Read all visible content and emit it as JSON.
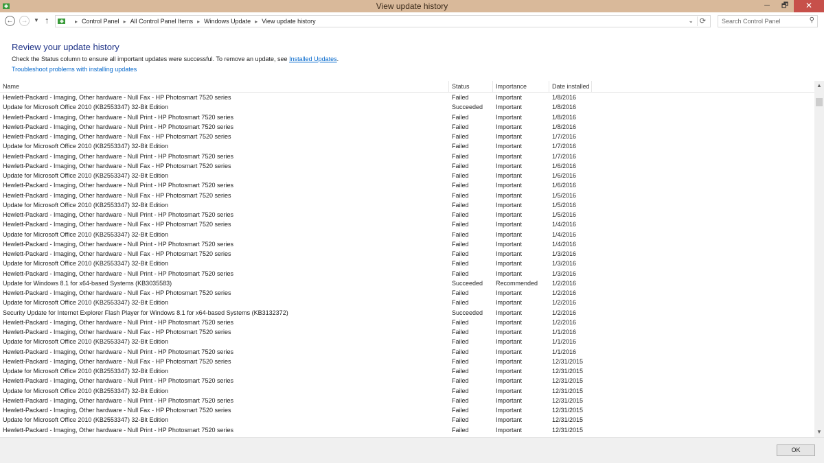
{
  "window": {
    "title": "View update history",
    "minimize": "─",
    "maximize": "🗗",
    "close": "✕"
  },
  "nav": {
    "breadcrumbs": [
      "Control Panel",
      "All Control Panel Items",
      "Windows Update",
      "View update history"
    ],
    "search_placeholder": "Search Control Panel"
  },
  "page": {
    "heading": "Review your update history",
    "desc_text": "Check the Status column to ensure all important updates were successful. To remove an update, see ",
    "installed_updates_link": "Installed Updates",
    "desc_end": ".",
    "troubleshoot_link": "Troubleshoot problems with installing updates"
  },
  "table": {
    "columns": [
      "Name",
      "Status",
      "Importance",
      "Date installed"
    ],
    "rows": [
      [
        "Hewlett-Packard  - Imaging, Other hardware - Null Fax - HP Photosmart 7520 series",
        "Failed",
        "Important",
        "1/8/2016"
      ],
      [
        "Update for Microsoft Office 2010 (KB2553347) 32-Bit Edition",
        "Succeeded",
        "Important",
        "1/8/2016"
      ],
      [
        "Hewlett-Packard  - Imaging, Other hardware - Null Print - HP Photosmart 7520 series",
        "Failed",
        "Important",
        "1/8/2016"
      ],
      [
        "Hewlett-Packard  - Imaging, Other hardware - Null Print - HP Photosmart 7520 series",
        "Failed",
        "Important",
        "1/8/2016"
      ],
      [
        "Hewlett-Packard  - Imaging, Other hardware - Null Fax - HP Photosmart 7520 series",
        "Failed",
        "Important",
        "1/7/2016"
      ],
      [
        "Update for Microsoft Office 2010 (KB2553347) 32-Bit Edition",
        "Failed",
        "Important",
        "1/7/2016"
      ],
      [
        "Hewlett-Packard  - Imaging, Other hardware - Null Print - HP Photosmart 7520 series",
        "Failed",
        "Important",
        "1/7/2016"
      ],
      [
        "Hewlett-Packard  - Imaging, Other hardware - Null Fax - HP Photosmart 7520 series",
        "Failed",
        "Important",
        "1/6/2016"
      ],
      [
        "Update for Microsoft Office 2010 (KB2553347) 32-Bit Edition",
        "Failed",
        "Important",
        "1/6/2016"
      ],
      [
        "Hewlett-Packard  - Imaging, Other hardware - Null Print - HP Photosmart 7520 series",
        "Failed",
        "Important",
        "1/6/2016"
      ],
      [
        "Hewlett-Packard  - Imaging, Other hardware - Null Fax - HP Photosmart 7520 series",
        "Failed",
        "Important",
        "1/5/2016"
      ],
      [
        "Update for Microsoft Office 2010 (KB2553347) 32-Bit Edition",
        "Failed",
        "Important",
        "1/5/2016"
      ],
      [
        "Hewlett-Packard  - Imaging, Other hardware - Null Print - HP Photosmart 7520 series",
        "Failed",
        "Important",
        "1/5/2016"
      ],
      [
        "Hewlett-Packard  - Imaging, Other hardware - Null Fax - HP Photosmart 7520 series",
        "Failed",
        "Important",
        "1/4/2016"
      ],
      [
        "Update for Microsoft Office 2010 (KB2553347) 32-Bit Edition",
        "Failed",
        "Important",
        "1/4/2016"
      ],
      [
        "Hewlett-Packard  - Imaging, Other hardware - Null Print - HP Photosmart 7520 series",
        "Failed",
        "Important",
        "1/4/2016"
      ],
      [
        "Hewlett-Packard  - Imaging, Other hardware - Null Fax - HP Photosmart 7520 series",
        "Failed",
        "Important",
        "1/3/2016"
      ],
      [
        "Update for Microsoft Office 2010 (KB2553347) 32-Bit Edition",
        "Failed",
        "Important",
        "1/3/2016"
      ],
      [
        "Hewlett-Packard  - Imaging, Other hardware - Null Print - HP Photosmart 7520 series",
        "Failed",
        "Important",
        "1/3/2016"
      ],
      [
        "Update for Windows 8.1 for x64-based Systems (KB3035583)",
        "Succeeded",
        "Recommended",
        "1/2/2016"
      ],
      [
        "Hewlett-Packard  - Imaging, Other hardware - Null Fax - HP Photosmart 7520 series",
        "Failed",
        "Important",
        "1/2/2016"
      ],
      [
        "Update for Microsoft Office 2010 (KB2553347) 32-Bit Edition",
        "Failed",
        "Important",
        "1/2/2016"
      ],
      [
        "Security Update for Internet Explorer Flash Player for Windows 8.1 for x64-based Systems (KB3132372)",
        "Succeeded",
        "Important",
        "1/2/2016"
      ],
      [
        "Hewlett-Packard  - Imaging, Other hardware - Null Print - HP Photosmart 7520 series",
        "Failed",
        "Important",
        "1/2/2016"
      ],
      [
        "Hewlett-Packard  - Imaging, Other hardware - Null Fax - HP Photosmart 7520 series",
        "Failed",
        "Important",
        "1/1/2016"
      ],
      [
        "Update for Microsoft Office 2010 (KB2553347) 32-Bit Edition",
        "Failed",
        "Important",
        "1/1/2016"
      ],
      [
        "Hewlett-Packard  - Imaging, Other hardware - Null Print - HP Photosmart 7520 series",
        "Failed",
        "Important",
        "1/1/2016"
      ],
      [
        "Hewlett-Packard  - Imaging, Other hardware - Null Fax - HP Photosmart 7520 series",
        "Failed",
        "Important",
        "12/31/2015"
      ],
      [
        "Update for Microsoft Office 2010 (KB2553347) 32-Bit Edition",
        "Failed",
        "Important",
        "12/31/2015"
      ],
      [
        "Hewlett-Packard  - Imaging, Other hardware - Null Print - HP Photosmart 7520 series",
        "Failed",
        "Important",
        "12/31/2015"
      ],
      [
        "Update for Microsoft Office 2010 (KB2553347) 32-Bit Edition",
        "Failed",
        "Important",
        "12/31/2015"
      ],
      [
        "Hewlett-Packard  - Imaging, Other hardware - Null Print - HP Photosmart 7520 series",
        "Failed",
        "Important",
        "12/31/2015"
      ],
      [
        "Hewlett-Packard  - Imaging, Other hardware - Null Fax - HP Photosmart 7520 series",
        "Failed",
        "Important",
        "12/31/2015"
      ],
      [
        "Update for Microsoft Office 2010 (KB2553347) 32-Bit Edition",
        "Failed",
        "Important",
        "12/31/2015"
      ],
      [
        "Hewlett-Packard  - Imaging, Other hardware - Null Print - HP Photosmart 7520 series",
        "Failed",
        "Important",
        "12/31/2015"
      ]
    ]
  },
  "footer": {
    "ok_label": "OK"
  },
  "colors": {
    "titlebar": "#d9b99a",
    "heading": "#1e3287",
    "link": "#0066cc",
    "close": "#c7504a"
  }
}
